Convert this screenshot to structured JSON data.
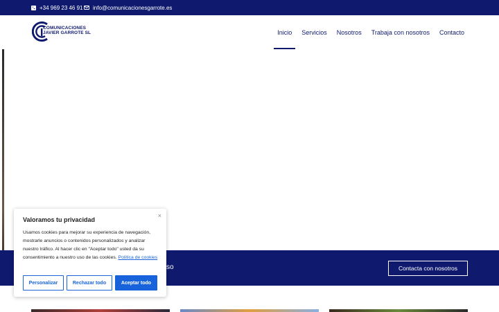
{
  "topbar": {
    "phone": "+34 969 23 46 91",
    "email": "info@comunicacionesgarrote.es"
  },
  "brand": {
    "line1": "COMUNICACIONES",
    "line2": "JAVIER GARROTE SL",
    "color": "#0f1a6e"
  },
  "nav": {
    "items": [
      {
        "label": "Inicio",
        "active": true
      },
      {
        "label": "Servicios"
      },
      {
        "label": "Nosotros"
      },
      {
        "label": "Trabaja con nosotros"
      },
      {
        "label": "Contacto"
      }
    ]
  },
  "band": {
    "partial_text": "so",
    "cta_label": "Contacta con nosotros"
  },
  "cookie": {
    "close": "×",
    "title": "Valoramos tu privacidad",
    "body": "Usamos cookies para mejorar su experiencia de navegación, mostrarle anuncios o contenidos personalizados y analizar nuestro tráfico. Al hacer clic en \"Aceptar todo\" usted da su consentimiento a nuestro uso de las cookies.",
    "policy_link": "Política de cookies",
    "buttons": {
      "customize": "Personalizar",
      "reject": "Rechazar todo",
      "accept": "Aceptar todo"
    },
    "accent": "#1863dc"
  },
  "icons": {
    "phone": "phone-square-icon",
    "email": "envelope-icon"
  }
}
